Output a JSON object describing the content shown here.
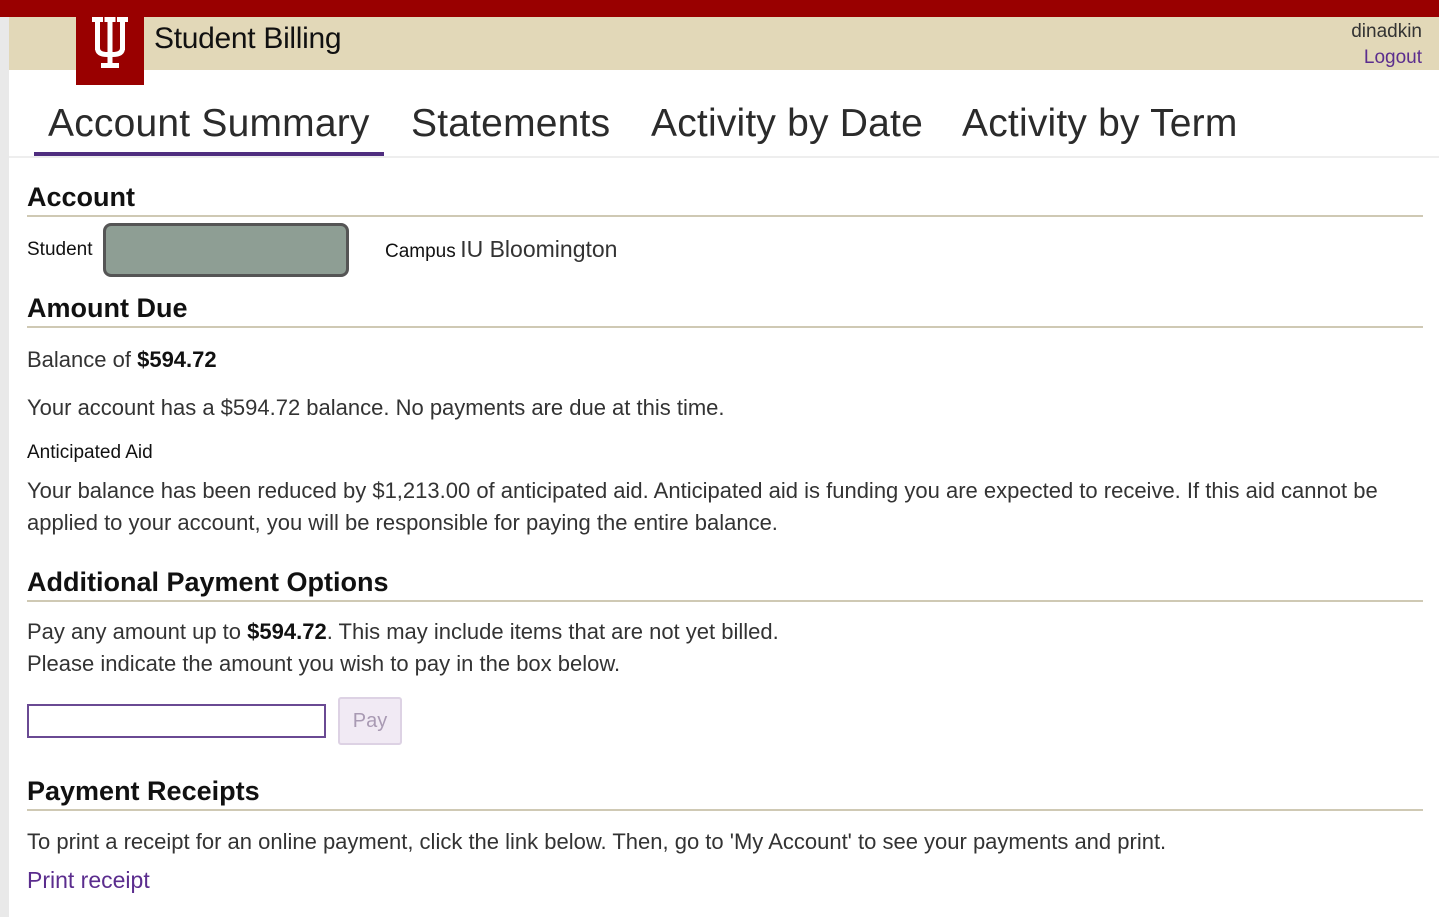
{
  "header": {
    "app_title": "Student Billing",
    "username": "dinadkin",
    "logout_label": "Logout"
  },
  "tabs": [
    {
      "label": "Account Summary",
      "active": true
    },
    {
      "label": "Statements",
      "active": false
    },
    {
      "label": "Activity by Date",
      "active": false
    },
    {
      "label": "Activity by Term",
      "active": false
    }
  ],
  "account": {
    "heading": "Account",
    "student_label": "Student",
    "campus_label": "Campus",
    "campus_value": "IU Bloomington"
  },
  "amount_due": {
    "heading": "Amount Due",
    "balance_prefix": "Balance of",
    "balance_value": "$594.72",
    "status_text": "Your account has a $594.72 balance. No payments are due at this time.",
    "aid_label": "Anticipated Aid",
    "aid_text": "Your balance has been reduced by $1,213.00 of anticipated aid. Anticipated aid is funding you are expected to receive. If this aid cannot be applied to your account, you will be responsible for paying the entire balance."
  },
  "payment_options": {
    "heading": "Additional Payment Options",
    "line1_prefix": "Pay any amount up to",
    "line1_amount": "$594.72",
    "line1_suffix": ". This may include items that are not yet billed.",
    "line2": "Please indicate the amount you wish to pay in the box below.",
    "pay_input_value": "",
    "pay_button_label": "Pay"
  },
  "receipts": {
    "heading": "Payment Receipts",
    "text": "To print a receipt for an online payment, click the link below. Then, go to 'My Account' to see your payments and print.",
    "link_label": "Print receipt"
  },
  "colors": {
    "crimson": "#990000",
    "cream": "#e2d8b8",
    "accent_purple": "#4f2d7f"
  }
}
